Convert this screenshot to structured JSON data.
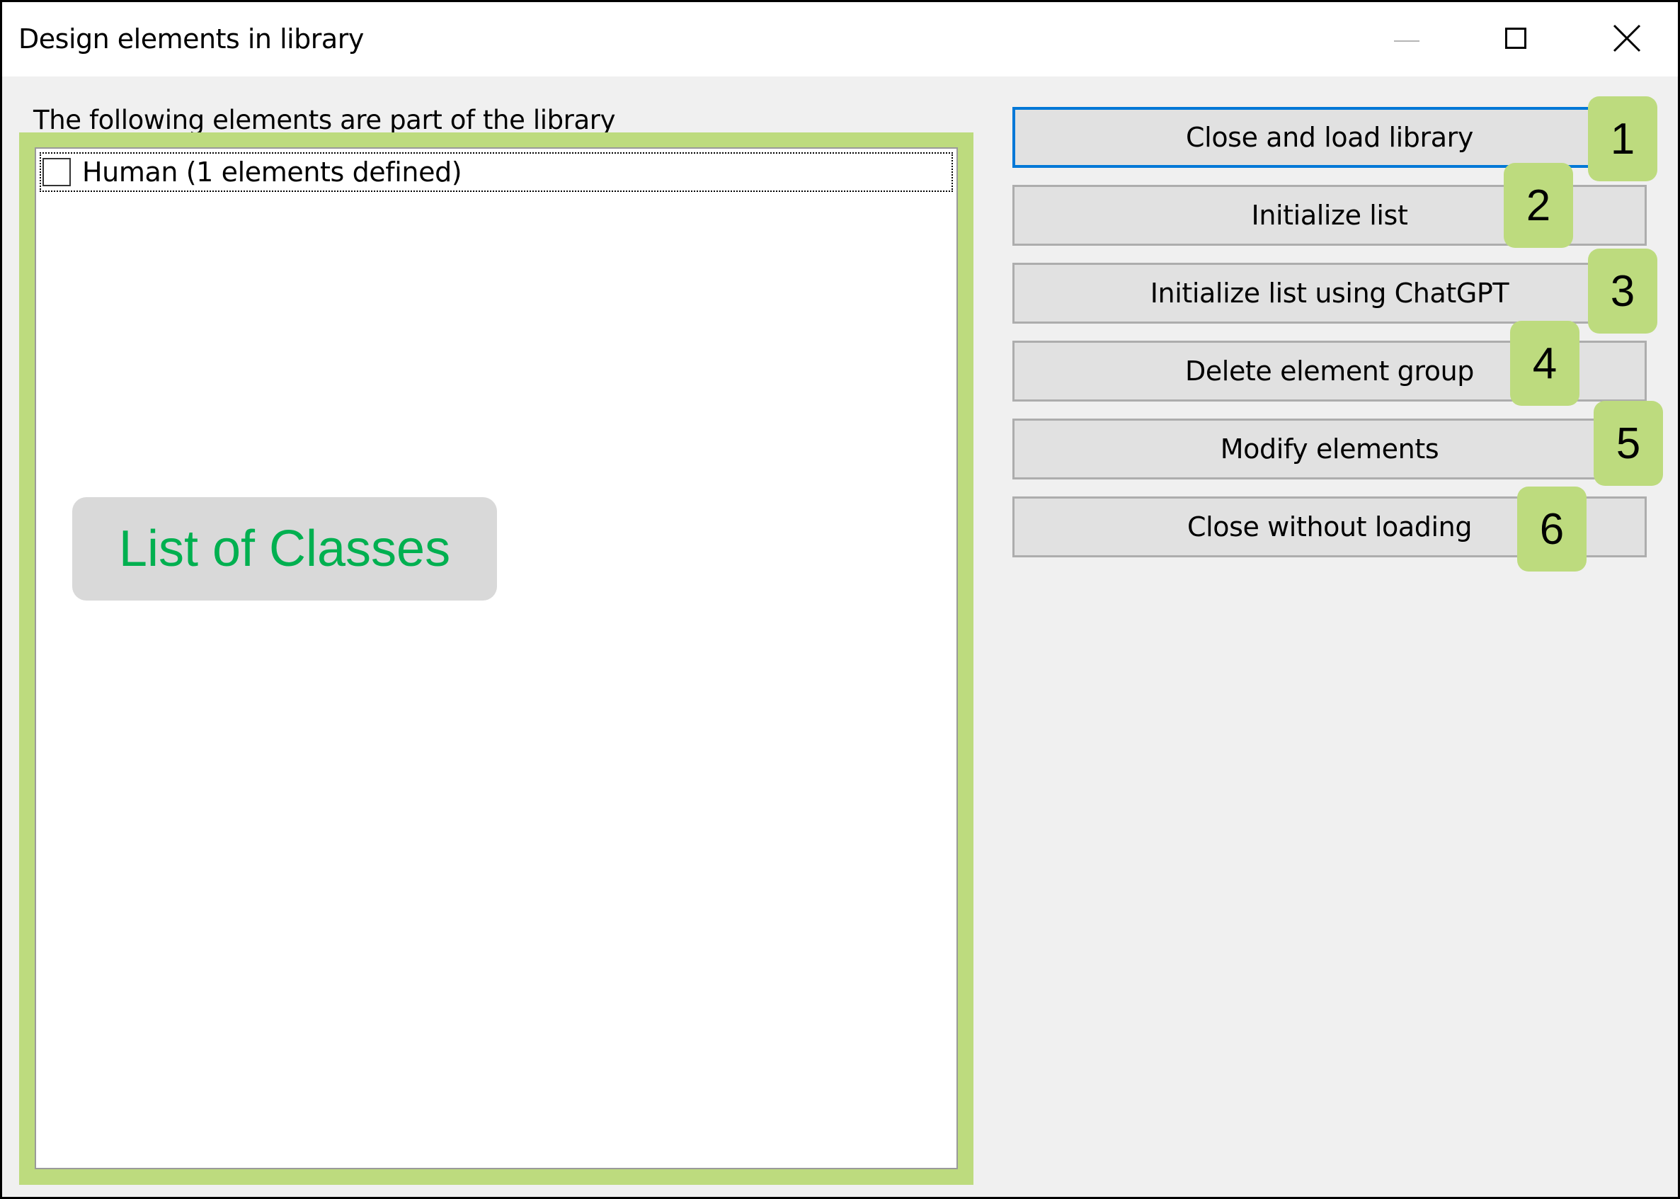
{
  "window": {
    "title": "Design elements in library",
    "controls": {
      "minimize": "minimize-icon",
      "maximize": "maximize-icon",
      "close": "close-icon"
    }
  },
  "main": {
    "label": "The following elements are part of the library",
    "list": {
      "items": [
        {
          "label": "Human (1 elements defined)",
          "checked": false
        }
      ]
    },
    "annotation": {
      "text": "List of Classes",
      "color": "#00b050"
    }
  },
  "buttons": [
    {
      "label": "Close and load library",
      "badge": "1",
      "default": true
    },
    {
      "label": "Initialize list",
      "badge": "2"
    },
    {
      "label": "Initialize list using ChatGPT",
      "badge": "3"
    },
    {
      "label": "Delete element group",
      "badge": "4"
    },
    {
      "label": "Modify elements",
      "badge": "5"
    },
    {
      "label": "Close without loading",
      "badge": "6"
    }
  ],
  "colors": {
    "highlight": "#bddb7e",
    "focus": "#0078d7"
  }
}
